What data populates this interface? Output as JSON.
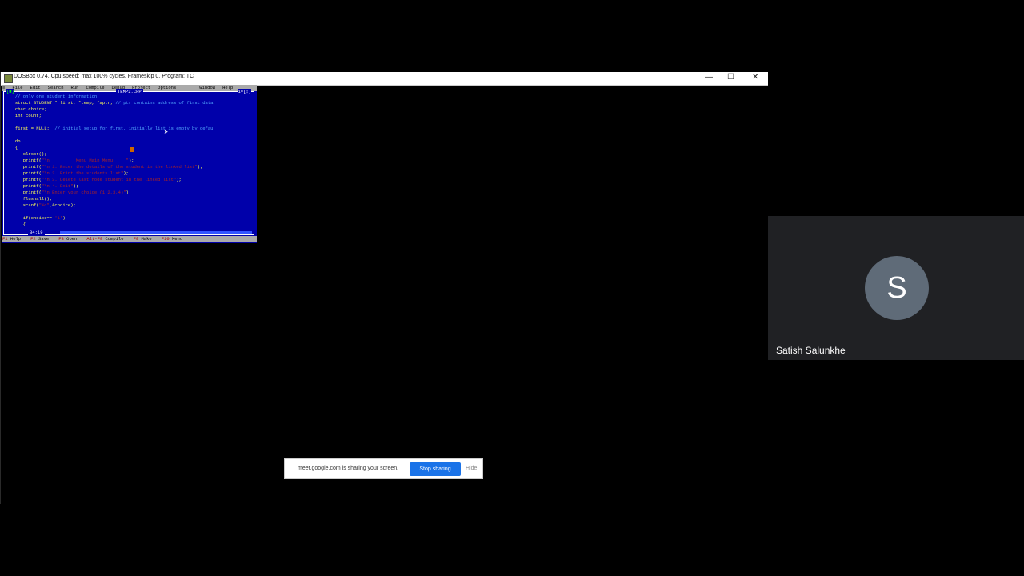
{
  "dosbox": {
    "title": "DOSBox 0.74, Cpu speed: max 100% cycles, Frameskip  0, Program:    TC",
    "minimize": "—",
    "maximize": "☐",
    "close": "✕"
  },
  "editor": {
    "menu": [
      "≡",
      "File",
      "Edit",
      "Search",
      "Run",
      "Compile",
      "Debug",
      "Project",
      "Options",
      "Window",
      "Help"
    ],
    "filename": "TEMP2.CPP",
    "window_num": "1=[↕]",
    "close_box": "[■]",
    "position": "34:19",
    "status_items": [
      {
        "key": "F1",
        "label": "Help"
      },
      {
        "key": "F2",
        "label": "Save"
      },
      {
        "key": "F3",
        "label": "Open"
      },
      {
        "key": "Alt-F9",
        "label": "Compile"
      },
      {
        "key": "F9",
        "label": "Make"
      },
      {
        "key": "F10",
        "label": "Menu"
      }
    ],
    "code": [
      [
        {
          "t": "   // only one student information",
          "c": "cmt"
        }
      ],
      [
        {
          "t": "   struct STUDENT * first, *temp, *aptr; ",
          "c": ""
        },
        {
          "t": "// ptr contains address of first data",
          "c": "cmt"
        }
      ],
      [
        {
          "t": "   char choice;",
          "c": ""
        }
      ],
      [
        {
          "t": "   int count;",
          "c": ""
        }
      ],
      [
        {
          "t": "",
          "c": ""
        }
      ],
      [
        {
          "t": "   first = NULL;  ",
          "c": ""
        },
        {
          "t": "// initial setup for first, initially list is empty by defau",
          "c": "cmt"
        }
      ],
      [
        {
          "t": "",
          "c": ""
        }
      ],
      [
        {
          "t": "   do",
          "c": ""
        }
      ],
      [
        {
          "t": "   {",
          "c": ""
        }
      ],
      [
        {
          "t": "      clrscr();",
          "c": ""
        }
      ],
      [
        {
          "t": "      printf(",
          "c": ""
        },
        {
          "t": "\"\\n          Menu Main Menu     \"",
          "c": "str"
        },
        {
          "t": ");",
          "c": ""
        }
      ],
      [
        {
          "t": "      printf(",
          "c": ""
        },
        {
          "t": "\"\\n 1. Enter the details of the student in the linked list\"",
          "c": "str"
        },
        {
          "t": ");",
          "c": ""
        }
      ],
      [
        {
          "t": "      printf(",
          "c": ""
        },
        {
          "t": "\"\\n 2. Print the students list\"",
          "c": "str"
        },
        {
          "t": ");",
          "c": ""
        }
      ],
      [
        {
          "t": "      printf(",
          "c": ""
        },
        {
          "t": "\"\\n 3. Delete last node student in the linked list\"",
          "c": "str"
        },
        {
          "t": ");",
          "c": ""
        }
      ],
      [
        {
          "t": "      printf(",
          "c": ""
        },
        {
          "t": "\"\\n 4. Exit\"",
          "c": "str"
        },
        {
          "t": ");",
          "c": ""
        }
      ],
      [
        {
          "t": "      printf(",
          "c": ""
        },
        {
          "t": "\"\\n Enter your choice (1,2,3,4)\"",
          "c": "str"
        },
        {
          "t": ");",
          "c": ""
        }
      ],
      [
        {
          "t": "      flushall();",
          "c": ""
        }
      ],
      [
        {
          "t": "      scanf(",
          "c": ""
        },
        {
          "t": "\"%c\"",
          "c": "str"
        },
        {
          "t": ",&choice);",
          "c": ""
        }
      ],
      [
        {
          "t": "",
          "c": ""
        }
      ],
      [
        {
          "t": "      if(choice== ",
          "c": ""
        },
        {
          "t": "'1'",
          "c": "str"
        },
        {
          "t": ")",
          "c": ""
        }
      ],
      [
        {
          "t": "      {",
          "c": ""
        }
      ]
    ]
  },
  "share": {
    "message": "meet.google.com is sharing your screen.",
    "stop_label": "Stop sharing",
    "hide_label": "Hide"
  },
  "participant": {
    "initial": "S",
    "name": "Satish Salunkhe"
  }
}
